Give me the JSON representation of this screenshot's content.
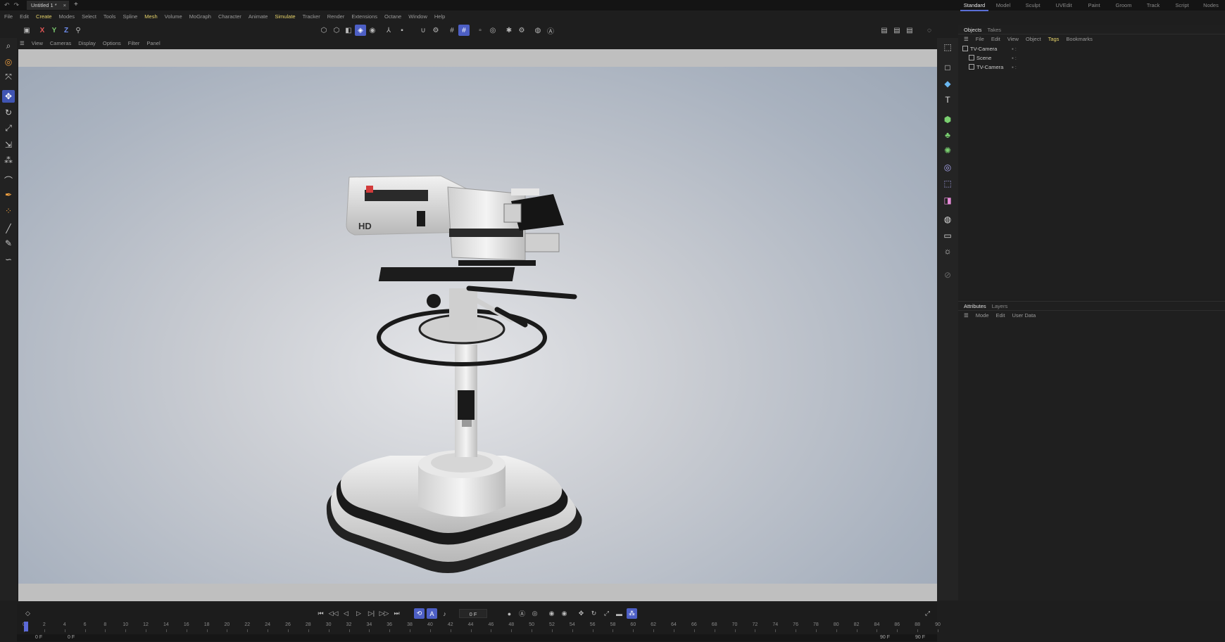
{
  "titlebar": {
    "doc_tab": "Untitled 1 *",
    "close": "×",
    "new_tab": "+",
    "history": "↶↷"
  },
  "layouts": [
    "Standard",
    "Model",
    "Sculpt",
    "UVEdit",
    "Paint",
    "Groom",
    "Track",
    "Script",
    "Nodes"
  ],
  "layouts_active": "Standard",
  "menu": [
    "File",
    "Edit",
    "Create",
    "Modes",
    "Select",
    "Tools",
    "Spline",
    "Mesh",
    "Volume",
    "MoGraph",
    "Character",
    "Animate",
    "Simulate",
    "Tracker",
    "Render",
    "Extensions",
    "Octane",
    "Window",
    "Help"
  ],
  "menu_highlight": [
    "Create",
    "Mesh",
    "Simulate"
  ],
  "toolbar": {
    "axis_x": "X",
    "axis_y": "Y",
    "axis_z": "Z"
  },
  "viewport_menu": [
    "View",
    "Cameras",
    "Display",
    "Options",
    "Filter",
    "Panel"
  ],
  "objects_panel": {
    "tabs": [
      "Objects",
      "Takes"
    ],
    "menu": [
      "File",
      "Edit",
      "View",
      "Object",
      "Tags",
      "Bookmarks"
    ],
    "menu_highlight": "Tags",
    "items": [
      {
        "label": "TV-Camera",
        "indent": 0
      },
      {
        "label": "Scene",
        "indent": 1
      },
      {
        "label": "TV-Camera",
        "indent": 1
      }
    ]
  },
  "attributes_panel": {
    "tabs": [
      "Attributes",
      "Layers"
    ],
    "menu": [
      "Mode",
      "Edit",
      "User Data"
    ]
  },
  "timeline": {
    "current_frame": "0 F",
    "range_start": "0 F",
    "range_start2": "0 F",
    "range_end": "90 F",
    "range_end2": "90 F",
    "ruler": [
      0,
      2,
      4,
      6,
      8,
      10,
      12,
      14,
      16,
      18,
      20,
      22,
      24,
      26,
      28,
      30,
      32,
      34,
      36,
      38,
      40,
      42,
      44,
      46,
      48,
      50,
      52,
      54,
      56,
      58,
      60,
      62,
      64,
      66,
      68,
      70,
      72,
      74,
      76,
      78,
      80,
      82,
      84,
      86,
      88,
      90
    ]
  },
  "colors": {
    "accent": "#4d5fc5",
    "highlight_text": "#e6d36a",
    "panel_bg": "#1f1f1f"
  },
  "icons": [
    "undo-icon",
    "redo-icon",
    "search-icon",
    "move-icon",
    "rotate-icon",
    "scale-icon",
    "camera-icon",
    "cube-icon",
    "text-icon",
    "light-icon",
    "play-icon",
    "record-icon",
    "keyframe-icon"
  ]
}
